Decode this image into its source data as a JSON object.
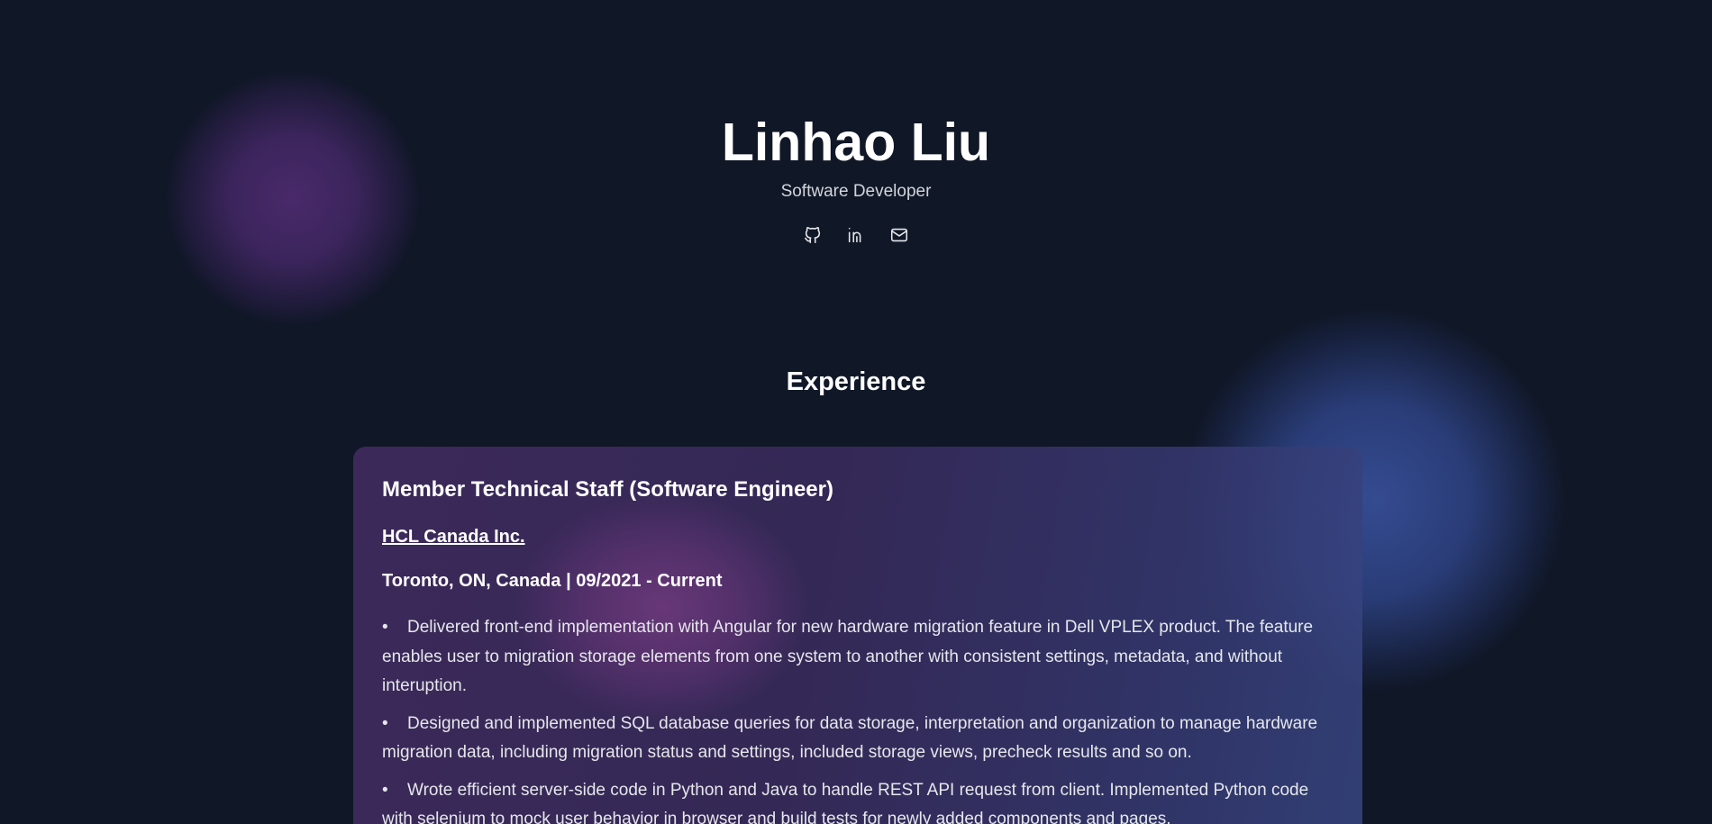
{
  "header": {
    "name": "Linhao Liu",
    "role": "Software Developer",
    "socials": [
      {
        "icon": "github-icon",
        "label": "GitHub"
      },
      {
        "icon": "linkedin-icon",
        "label": "LinkedIn"
      },
      {
        "icon": "mail-icon",
        "label": "Email"
      }
    ]
  },
  "experience": {
    "section_title": "Experience",
    "jobs": [
      {
        "title": "Member Technical Staff (Software Engineer)",
        "company": "HCL Canada Inc.",
        "location_dates": "Toronto, ON, Canada | 09/2021 - Current",
        "bullets": [
          "Delivered front-end implementation with Angular for new hardware migration feature in Dell VPLEX product. The feature enables user to migration storage elements from one system to another with consistent settings, metadata, and without interuption.",
          "Designed and implemented SQL database queries for data storage, interpretation and organization to manage hardware migration data, including migration status and settings, included storage views, precheck results and so on.",
          "Wrote efficient server-side code in Python and Java to handle REST API request from client. Implemented Python code with selenium to mock user behavior in browser and build tests for newly added components and pages."
        ]
      }
    ]
  },
  "colors": {
    "background": "#101727",
    "card_gradient_start": "#3e2a5c",
    "card_gradient_end": "#374682",
    "blob_purple": "#4c2a6e",
    "blob_blue": "#374e96",
    "text_primary": "#ffffff",
    "text_secondary": "#d1d5db"
  }
}
